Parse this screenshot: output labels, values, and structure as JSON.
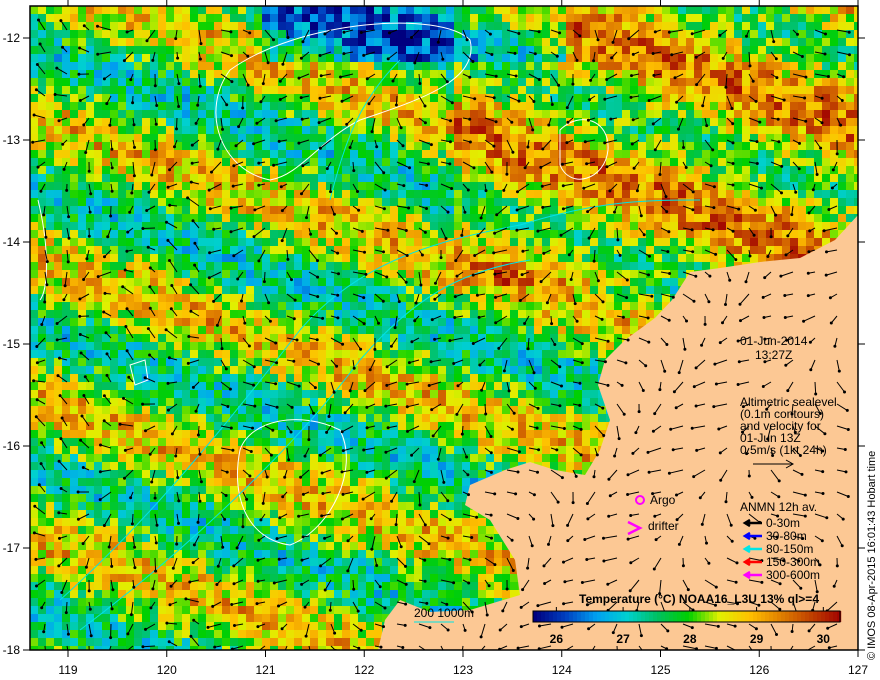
{
  "map": {
    "lon_ticks": [
      119,
      120,
      121,
      122,
      123,
      124,
      125,
      126,
      127
    ],
    "lat_ticks": [
      -12,
      -13,
      -14,
      -15,
      -16,
      -17,
      -18
    ],
    "lon_range": [
      118.6,
      127
    ],
    "lat_range": [
      -11.7,
      -18
    ],
    "colors": {
      "land": "#fcc894",
      "frame": "#000000",
      "contour": "#ffffff",
      "isobath": "#00e5e5"
    }
  },
  "datetime": {
    "date": "01-Jun-2014",
    "time": "13:27Z"
  },
  "altimetry": {
    "lines": [
      "Altimetric sealevel",
      "(0.1m contours)",
      "and velocity for",
      "01-Jun 13Z",
      "0.5m/s (1kt 24h)"
    ]
  },
  "markers": {
    "argo": "Argo",
    "drifter": "drifter",
    "argo_color": "#ff00ff"
  },
  "anmn": {
    "title": "ANMN 12h av.",
    "items": [
      {
        "label": "0-30m",
        "color": "#000000"
      },
      {
        "label": "30-80m",
        "color": "#0000ff"
      },
      {
        "label": "80-150m",
        "color": "#00e5e5"
      },
      {
        "label": "150-300m",
        "color": "#ff0000"
      },
      {
        "label": "300-600m",
        "color": "#ff00ff"
      }
    ]
  },
  "isobath_legend": "200  1000m",
  "colorbar": {
    "title": "Temperature (°C) NOAA16_L3U 13% ql>=4",
    "ticks": [
      "26",
      "27",
      "28",
      "29",
      "30"
    ],
    "range": [
      25.65,
      30.25
    ],
    "stops": [
      "#00007f",
      "#0040c0",
      "#00a0f0",
      "#00d0d0",
      "#00c060",
      "#00d000",
      "#e0f000",
      "#ffc000",
      "#e08000",
      "#c04000",
      "#a00000"
    ]
  },
  "credit": "© IMOS 08-Apr-2015 16:01:43 Hobart time"
}
